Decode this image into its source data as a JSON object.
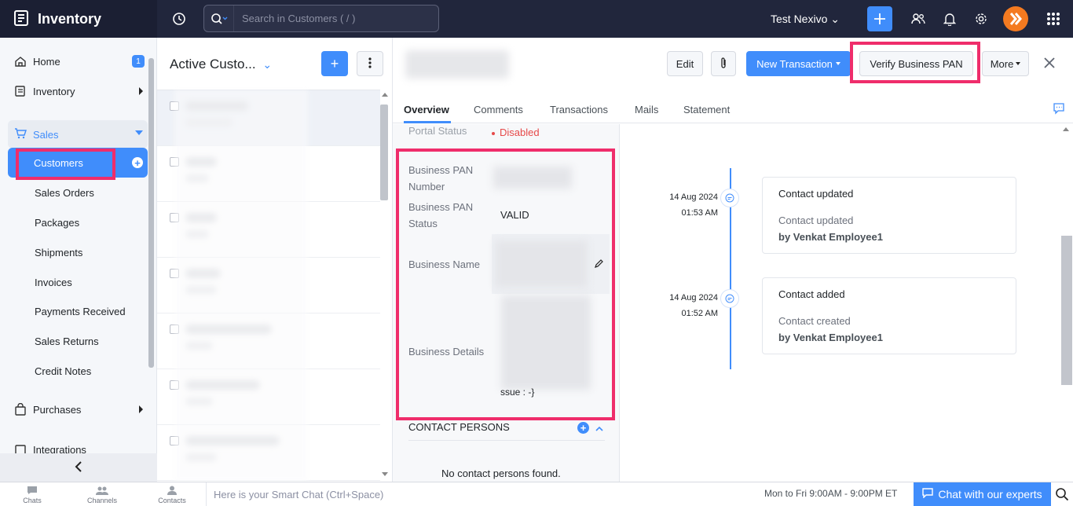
{
  "app": {
    "name": "Inventory"
  },
  "topbar": {
    "search_placeholder": "Search in Customers ( / )",
    "org_name": "Test Nexivo"
  },
  "sidebar": {
    "home": "Home",
    "home_badge": "1",
    "inventory": "Inventory",
    "sales": "Sales",
    "sales_items": [
      "Customers",
      "Sales Orders",
      "Packages",
      "Shipments",
      "Invoices",
      "Payments Received",
      "Sales Returns",
      "Credit Notes"
    ],
    "purchases": "Purchases",
    "integrations": "Integrations"
  },
  "list": {
    "title": "Active Custo..."
  },
  "detail": {
    "buttons": {
      "edit": "Edit",
      "new_transaction": "New Transaction",
      "verify_pan": "Verify Business PAN",
      "more": "More"
    },
    "tabs": [
      "Overview",
      "Comments",
      "Transactions",
      "Mails",
      "Statement"
    ],
    "fields": {
      "portal_status_label": "Portal Status",
      "portal_status_value": "Disabled",
      "pan_number_label": "Business PAN Number",
      "pan_status_label": "Business PAN Status",
      "pan_status_value": "VALID",
      "business_name_label": "Business Name",
      "business_details_label": "Business Details",
      "business_details_tail": "ssue : -}"
    },
    "contacts": {
      "header": "CONTACT PERSONS",
      "empty": "No contact persons found."
    },
    "timeline": [
      {
        "date": "14 Aug 2024",
        "time": "01:53 AM",
        "title": "Contact updated",
        "desc": "Contact updated",
        "by": "by Venkat Employee1"
      },
      {
        "date": "14 Aug 2024",
        "time": "01:52 AM",
        "title": "Contact added",
        "desc": "Contact created",
        "by": "by Venkat Employee1"
      }
    ]
  },
  "bottombar": {
    "chats": "Chats",
    "channels": "Channels",
    "contacts": "Contacts",
    "smart_chat": "Here is your Smart Chat (Ctrl+Space)",
    "hours": "Mon to Fri 9:00AM - 9:00PM ET",
    "chat_experts": "Chat with our experts"
  },
  "colors": {
    "accent": "#408dfb",
    "topbar": "#21263c",
    "highlight": "#ef2d6b"
  }
}
